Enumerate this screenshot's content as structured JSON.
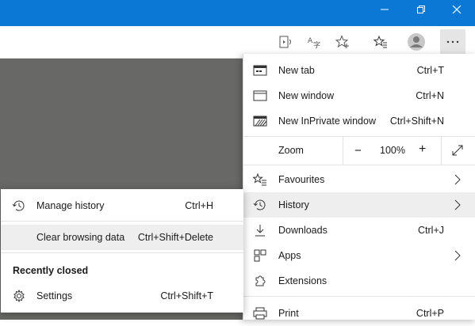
{
  "colors": {
    "titlebar": "#0a78d4",
    "content": "#686867",
    "menu_hover": "#eeeeee"
  },
  "titlebar": {
    "icons": [
      "minimize-icon",
      "restore-icon",
      "close-icon"
    ]
  },
  "toolbar": {
    "icons": [
      "read-aloud-icon",
      "translate-icon",
      "add-favorite-icon",
      "favorites-icon",
      "profile-icon",
      "more-icon"
    ]
  },
  "menu": {
    "new_tab": {
      "label": "New tab",
      "shortcut": "Ctrl+T"
    },
    "new_window": {
      "label": "New window",
      "shortcut": "Ctrl+N"
    },
    "new_inprivate": {
      "label": "New InPrivate window",
      "shortcut": "Ctrl+Shift+N"
    },
    "zoom": {
      "label": "Zoom",
      "minus": "−",
      "value": "100%",
      "plus": "+"
    },
    "favourites": {
      "label": "Favourites"
    },
    "history": {
      "label": "History"
    },
    "downloads": {
      "label": "Downloads",
      "shortcut": "Ctrl+J"
    },
    "apps": {
      "label": "Apps"
    },
    "extensions": {
      "label": "Extensions"
    },
    "print": {
      "label": "Print",
      "shortcut": "Ctrl+P"
    }
  },
  "history_submenu": {
    "manage": {
      "label": "Manage history",
      "shortcut": "Ctrl+H"
    },
    "clear": {
      "label": "Clear browsing data",
      "shortcut": "Ctrl+Shift+Delete"
    },
    "recently_closed": "Recently closed",
    "settings": {
      "label": "Settings",
      "shortcut": "Ctrl+Shift+T"
    }
  }
}
